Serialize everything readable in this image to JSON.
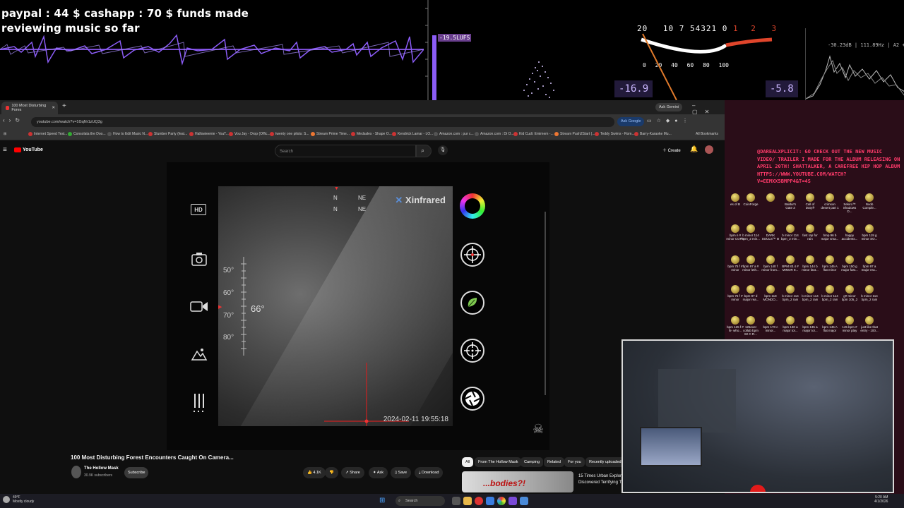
{
  "overlay": {
    "funds_line1": "paypal : 44 $  cashapp : 70 $ funds made",
    "funds_line2": "reviewing music so far",
    "lufs_badge": "-19.5LUFS",
    "vu_scale_top": [
      "20",
      "10",
      "7",
      "5",
      "4",
      "3",
      "2",
      "1",
      "0",
      "1",
      "2",
      "3"
    ],
    "vu_scale_bottom": [
      "0",
      "20",
      "40",
      "60",
      "80",
      "100"
    ],
    "vu_left_value": "-16.9",
    "vu_right_value": "-5.8",
    "spectrum_info": "-30.23dB | 111.89Hz | A2 + 26 Cents",
    "accent_purple": "#8b5cf6",
    "accent_red": "#e0452b"
  },
  "browser": {
    "tab_title": "100 Most Disturbing Fores",
    "url": "youtube.com/watch?v=1GqNr1zUQ3g",
    "ask_google": "Ask Google",
    "ask_gemini": "Ask Gemini",
    "bookmarks": [
      "Internet Speed Test...",
      "Consolata the Doo...",
      "How to Edit Music N...",
      "Slumber Party (feat...",
      "Hallowieenie - YouT...",
      "Vou Jay - Drop (Offic...",
      "twenty one pilots: S...",
      "Stream Prime Time...",
      "Medsales - Shape O...",
      "Kendrick Lamar - LO...",
      "Amazon.com : pur c...",
      "Amazon.com : Di O...",
      "Kid Cudi: Emimem -...",
      "Stream Push2Start (...",
      "Teddy Swims - Rom...",
      "Barry-Karaoke Mu..."
    ],
    "all_bookmarks": "All Bookmarks"
  },
  "youtube": {
    "logo": "YouTube",
    "search_placeholder": "Search",
    "create_label": "Create",
    "video": {
      "brand": "Xinfrared",
      "compass": [
        "N",
        "NE",
        "N",
        "NE"
      ],
      "angle": "66°",
      "scale": [
        "50°",
        "60°",
        "70°",
        "80°"
      ],
      "timestamp": "2024-02-11 19:55:18",
      "left_labels": [
        "HD"
      ]
    },
    "title": "100 Most Disturbing Forest Encounters Caught On Camera...",
    "channel": "The Hollow Mask",
    "subscribers": "30.9K subscribers",
    "subscribe_label": "Subscribe",
    "likes": "4.1K",
    "share_label": "Share",
    "ask_label": "Ask",
    "save_label": "Save",
    "download_label": "Download",
    "chips": [
      "All",
      "From The Hollow Mask",
      "Camping",
      "Related",
      "For you",
      "Recently uploaded"
    ],
    "rec_title_line1": "15 Times Urban Explorers",
    "rec_title_line2": "Discovered Terrifying This",
    "rec_thumb_text": "...bodies?!"
  },
  "desktop": {
    "promo": "@DAREALXPLICIT: GO CHECK OUT THE NEW MUSIC VIDEO/ TRAILER I MADE FOR THE ALBUM RELEASING ON APRIL 20TH! SHATTALKER, A CAREFREE HIP HOP ALBUM HTTPS://WWW.YOUTUBE.COM/WATCH? V=EEMXX5BMPP4&T=4S",
    "icons_row1": [
      "es of B",
      "CoinForge",
      "",
      "Baldur's Gate 3",
      "Call of Duty®",
      "crimson desert part 1",
      "Sekiro™ Shadows D...",
      "Noob Comple..."
    ],
    "icons_row2": [
      "bpm n # minor COPY",
      "b minor 114 bpm_2 min...",
      "DARK SOULS™ III",
      "b minor 114 bpm_2 min...",
      "fast rap for rain",
      "bmp 96 b major sma...",
      "happy accidents...",
      "bpm 119 g minor SO..."
    ],
    "icons_row3": [
      "bpm 75 f # minor",
      "bpm 97 a # minor leth...",
      "bpm 140 f minor from...",
      "BPM 83.4 # MINOR 8...",
      "bpm 144 b minor fast...",
      "bpm 145 A flat minor",
      "bpm 150 g major fast...",
      "bpm 97 a major rea..."
    ],
    "icons_row4": [
      "bpm 75 f # minor",
      "bpm 97 d major rea...",
      "bpm 118 MONDO...",
      "b minor 114 bpm_2 rain",
      "b minor 114 bpm_2 rain",
      "b minor 114 bpm_2 rain",
      "g# minor bpm 105_2",
      "b minor 114 bpm_2 rain"
    ],
    "icons_row5": [
      "bpm 125 f # hi- who...",
      "125ever collab bpm 82 C R...",
      "bpm 170 c minor...",
      "bpm 130 a major tor...",
      "bpm 135 a major tor...",
      "bpm 145 A flat major",
      "145 bpm # minor play",
      "just like that entry - 100..."
    ]
  },
  "taskbar": {
    "weather_temp": "49°F",
    "weather_desc": "Mostly cloudy",
    "search_label": "Search",
    "time": "5:20 AM",
    "date": "4/1/2026"
  }
}
